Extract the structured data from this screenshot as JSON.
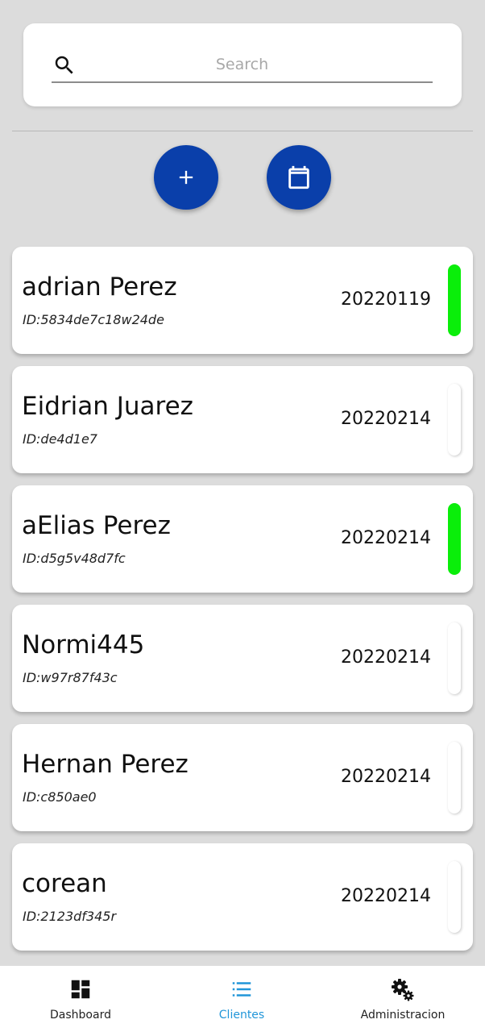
{
  "search": {
    "placeholder": "Search",
    "value": ""
  },
  "actions": {
    "add": "plus-icon",
    "calendar": "calendar-icon",
    "accent": "#0a3faa"
  },
  "clients": [
    {
      "name": "adrian Perez",
      "id": "ID:5834de7c18w24de",
      "date": "20220119",
      "active": true
    },
    {
      "name": "Eidrian Juarez",
      "id": "ID:de4d1e7",
      "date": "20220214",
      "active": false
    },
    {
      "name": "aElias Perez",
      "id": "ID:d5g5v48d7fc",
      "date": "20220214",
      "active": true
    },
    {
      "name": "Normi445",
      "id": "ID:w97r87f43c",
      "date": "20220214",
      "active": false
    },
    {
      "name": "Hernan Perez",
      "id": "ID:c850ae0",
      "date": "20220214",
      "active": false
    },
    {
      "name": "corean",
      "id": "ID:2123df345r",
      "date": "20220214",
      "active": false
    }
  ],
  "status_colors": {
    "active": "#0aee0a",
    "inactive": "#ffffff"
  },
  "nav": {
    "active_color": "#2196d9",
    "items": [
      {
        "label": "Dashboard",
        "icon": "dashboard-icon",
        "active": false
      },
      {
        "label": "Clientes",
        "icon": "list-icon",
        "active": true
      },
      {
        "label": "Administracion",
        "icon": "gears-icon",
        "active": false
      }
    ]
  }
}
